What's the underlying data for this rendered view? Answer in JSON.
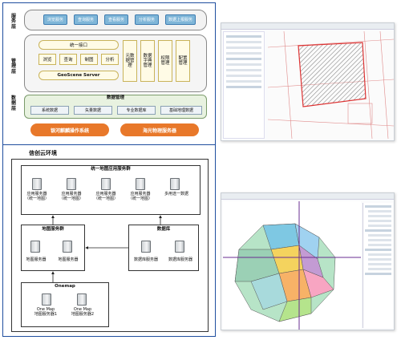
{
  "left_top": {
    "layers": {
      "service": "服\n务\n层",
      "management": "管\n理\n层",
      "data": "数\n据\n层"
    },
    "service_chips": [
      "浏览服务",
      "查询服务",
      "查看服务",
      "分析服务",
      "数据上报服务"
    ],
    "entry": "统一接口",
    "functions": [
      "浏览",
      "查询",
      "制图",
      "分析"
    ],
    "vertical_mgmt": [
      "元数据管理",
      "数据字典管理",
      "权限管理",
      "配置管理"
    ],
    "server": "GeoScene Server",
    "data_mgmt_title": "数据管理",
    "data_items": [
      "系统数据",
      "矢量数据",
      "专业数据库",
      "基础地理数据"
    ],
    "bottom_pills": [
      "银河麒麟操作系统",
      "海光物理服务器"
    ]
  },
  "left_bottom": {
    "title": "信创云环境",
    "unified_title": "统一地图应用服务群",
    "app_servers": [
      "应用服务器\n（统一地图）",
      "应用服务器\n（统一地图）",
      "应用服务器\n（统一地图）",
      "应用服务器\n（统一地图）",
      "多用途一数据"
    ],
    "map_group_title": "地图服务群",
    "map_servers": [
      "地图服务器",
      "地图服务器"
    ],
    "db_title": "数据库",
    "db_servers": [
      "数据库服务器",
      "数据库服务器"
    ],
    "onemap_title": "Onemap",
    "onemap_servers": [
      "One Map\n地图服务器1",
      "One Map\n地图服务器2"
    ]
  }
}
